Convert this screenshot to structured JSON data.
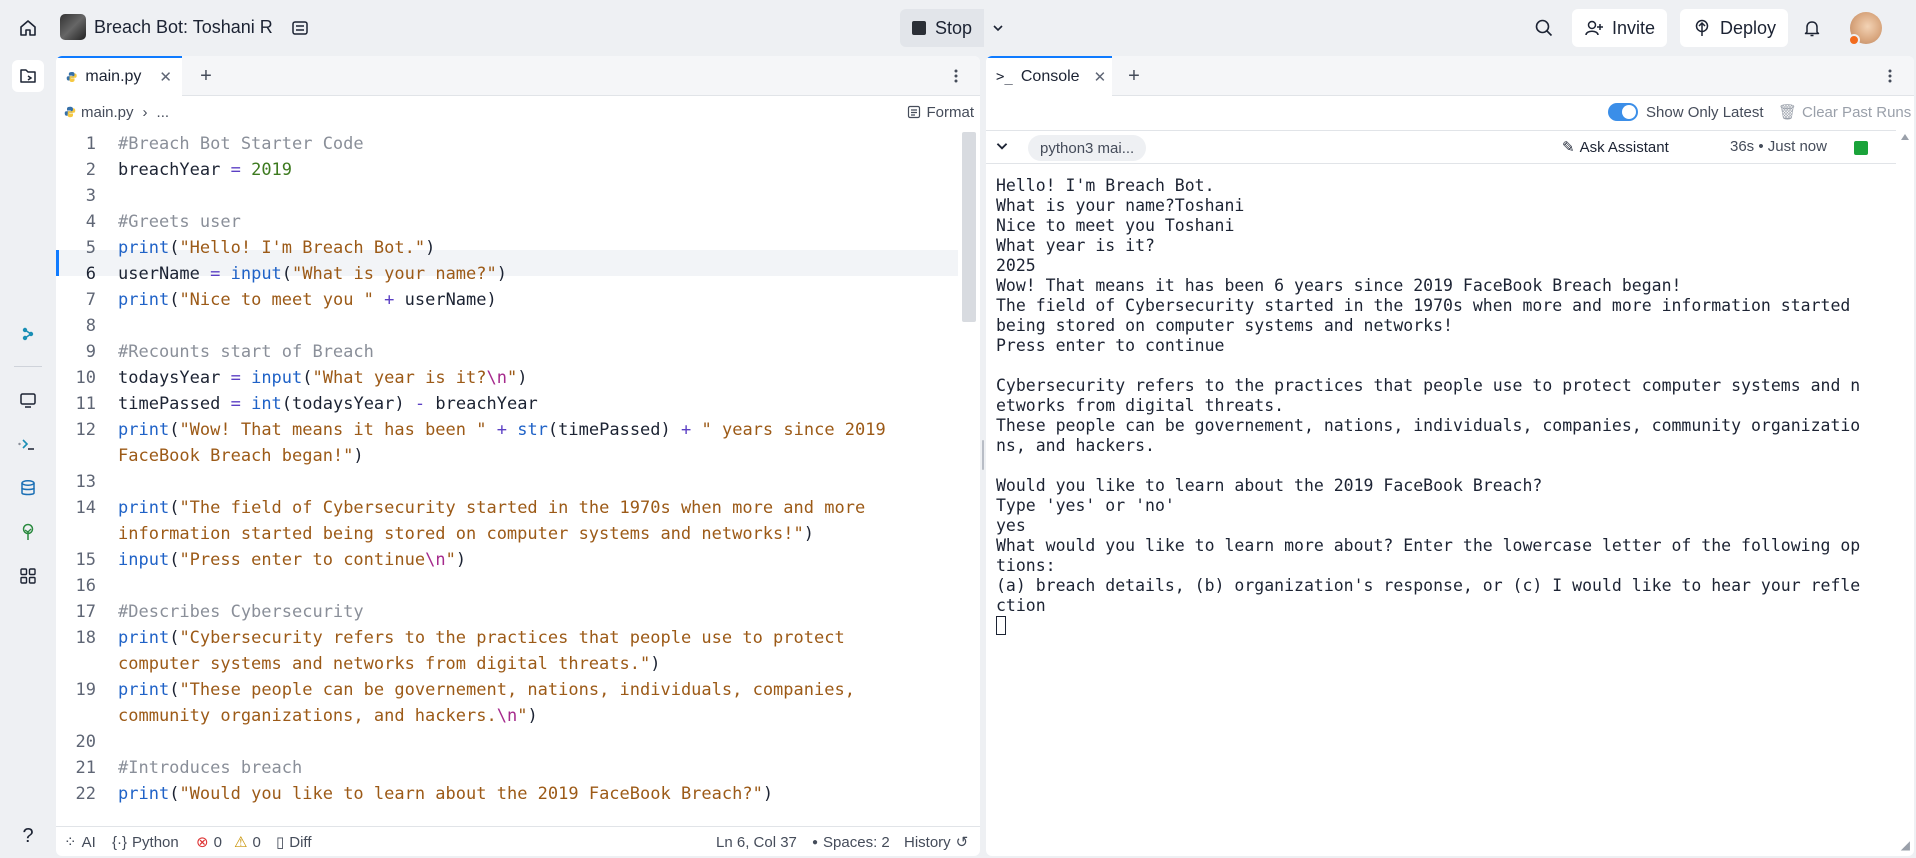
{
  "header": {
    "repl_name": "Breach Bot: Toshani R",
    "stop_label": "Stop",
    "invite_label": "Invite",
    "deploy_label": "Deploy"
  },
  "editor": {
    "tab_label": "main.py",
    "breadcrumb_file": "main.py",
    "breadcrumb_more": "...",
    "format_label": "Format",
    "lines": [
      {
        "n": "1"
      },
      {
        "n": "2"
      },
      {
        "n": "3"
      },
      {
        "n": "4"
      },
      {
        "n": "5"
      },
      {
        "n": "6"
      },
      {
        "n": "7"
      },
      {
        "n": "8"
      },
      {
        "n": "9"
      },
      {
        "n": "10"
      },
      {
        "n": "11"
      },
      {
        "n": "12"
      },
      {
        "n": "13"
      },
      {
        "n": "14"
      },
      {
        "n": "15"
      },
      {
        "n": "16"
      },
      {
        "n": "17"
      },
      {
        "n": "18"
      },
      {
        "n": "19"
      },
      {
        "n": "20"
      },
      {
        "n": "21"
      },
      {
        "n": "22"
      }
    ],
    "code": {
      "l1": "#Breach Bot Starter Code",
      "l2_var": "breachYear",
      "l2_op": " = ",
      "l2_num": "2019",
      "l4": "#Greets user",
      "l5_fn": "print",
      "l5_str": "\"Hello! I'm Breach Bot.\"",
      "l6_var": "userName",
      "l6_fn": "input",
      "l6_str": "\"What is your name?\"",
      "l7_fn": "print",
      "l7_str": "\"Nice to meet you \"",
      "l7_rest": "userName",
      "l9": "#Recounts start of Breach",
      "l10_var": "todaysYear",
      "l10_fn": "input",
      "l10_str": "\"What year is it?",
      "l10_esc": "\\n",
      "l10_end": "\"",
      "l11_var": "timePassed",
      "l11_fn": "int",
      "l11_arg": "todaysYear",
      "l11_rest": "breachYear",
      "l12_fn": "print",
      "l12_str1": "\"Wow! That means it has been \"",
      "l12_fn2": "str",
      "l12_arg": "timePassed",
      "l12_str2": "\" years since 2019",
      "l12b_str": "FaceBook Breach began!\"",
      "l14_fn": "print",
      "l14_str": "\"The field of Cybersecurity started in the 1970s when more and more",
      "l14b_str": "information started being stored on computer systems and networks!\"",
      "l15_fn": "input",
      "l15_str": "\"Press enter to continue",
      "l15_esc": "\\n",
      "l15_end": "\"",
      "l17": "#Describes Cybersecurity",
      "l18_fn": "print",
      "l18_str": "\"Cybersecurity refers to the practices that people use to protect",
      "l18b_str": "computer systems and networks from digital threats.\"",
      "l19_fn": "print",
      "l19_str": "\"These people can be governement, nations, individuals, companies,",
      "l19b_str": "community organizations, and hackers.",
      "l19b_esc": "\\n",
      "l19b_end": "\"",
      "l21": "#Introduces breach",
      "l22_fn": "print",
      "l22_str": "\"Would you like to learn about the 2019 FaceBook Breach?\""
    },
    "status": {
      "ai": "AI",
      "lang": "Python",
      "errors": "0",
      "warnings": "0",
      "diff": "Diff",
      "position": "Ln 6, Col 37",
      "spaces": "Spaces: 2",
      "history": "History"
    }
  },
  "console": {
    "tab_label": "Console",
    "show_latest_label": "Show Only Latest",
    "clear_label": "Clear Past Runs",
    "run_chip": "python3 mai...",
    "ask_assistant": "Ask Assistant",
    "run_time": "36s • Just now",
    "output": "Hello! I'm Breach Bot.\nWhat is your name?Toshani\nNice to meet you Toshani\nWhat year is it?\n2025\nWow! That means it has been 6 years since 2019 FaceBook Breach began!\nThe field of Cybersecurity started in the 1970s when more and more information started\nbeing stored on computer systems and networks!\nPress enter to continue\n\nCybersecurity refers to the practices that people use to protect computer systems and n\networks from digital threats.\nThese people can be governement, nations, individuals, companies, community organizatio\nns, and hackers.\n\nWould you like to learn about the 2019 FaceBook Breach?\nType 'yes' or 'no'\nyes\nWhat would you like to learn more about? Enter the lowercase letter of the following op\ntions:\n(a) breach details, (b) organization's response, or (c) I would like to hear your refle\nction"
  },
  "colors": {
    "accent": "#0f7bff",
    "running": "#1aa33a"
  }
}
